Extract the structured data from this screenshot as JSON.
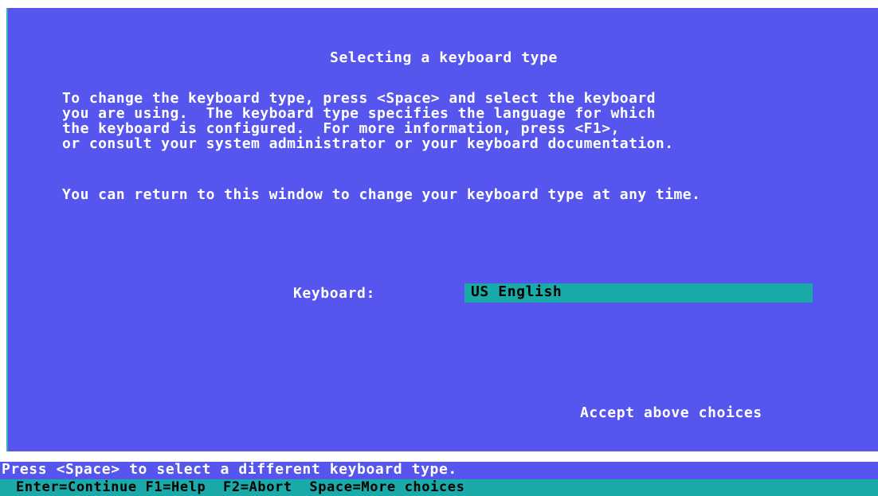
{
  "window": {
    "title": "Selecting a keyboard type",
    "paragraph1": "To change the keyboard type, press <Space> and select the keyboard\nyou are using.  The keyboard type specifies the language for which\nthe keyboard is configured.  For more information, press <F1>,\nor consult your system administrator or your keyboard documentation.",
    "paragraph2": "You can return to this window to change your keyboard type at any time.",
    "keyboard_label": "Keyboard:",
    "keyboard_value": "US English",
    "accept_label": "Accept above choices"
  },
  "status_bar": {
    "message": "Press <Space> to select a different keyboard type."
  },
  "key_bar": {
    "text": "Enter=Continue F1=Help  F2=Abort  Space=More choices"
  },
  "colors": {
    "background": "#5656ee",
    "highlight": "#1aaaaa",
    "text": "#ffffff"
  }
}
